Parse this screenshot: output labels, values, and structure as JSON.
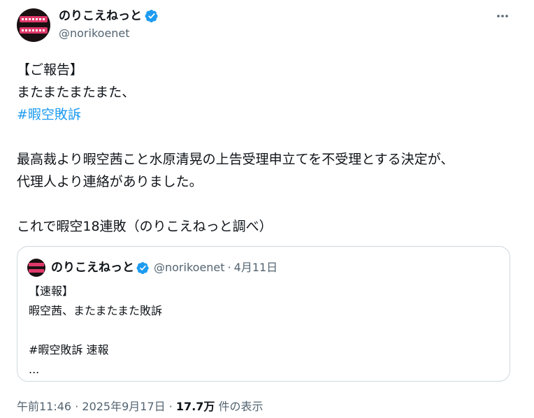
{
  "author": {
    "name": "のりこえねっと",
    "handle": "@norikoenet"
  },
  "icons": {
    "verified": "verified-badge-icon",
    "more": "more-options-icon",
    "verified_color": "#1d9bf0"
  },
  "tweet": {
    "line1": "【ご報告】",
    "line2": "またまたまたまた、",
    "hashtag1": "#暇空敗訴",
    "line4": "最高裁より暇空茜こと水原清晃の上告受理申立てを不受理とする決定が、",
    "line5": "代理人より連絡がありました。",
    "line6": "これで暇空18連敗（のりこえねっと調べ）"
  },
  "quote": {
    "name": "のりこえねっと",
    "handle": "@norikoenet",
    "separator": "·",
    "date": "4月11日",
    "line1": "【速報】",
    "line2": "暇空茜、またまたまた敗訴",
    "hashtag": "#暇空敗訴",
    "tag2": " 速報",
    "ellipsis": "..."
  },
  "meta": {
    "time": "午前11:46",
    "separator1": " · ",
    "date": "2025年9月17日",
    "separator2": " · ",
    "views": "17.7万",
    "views_label": " 件の表示"
  }
}
